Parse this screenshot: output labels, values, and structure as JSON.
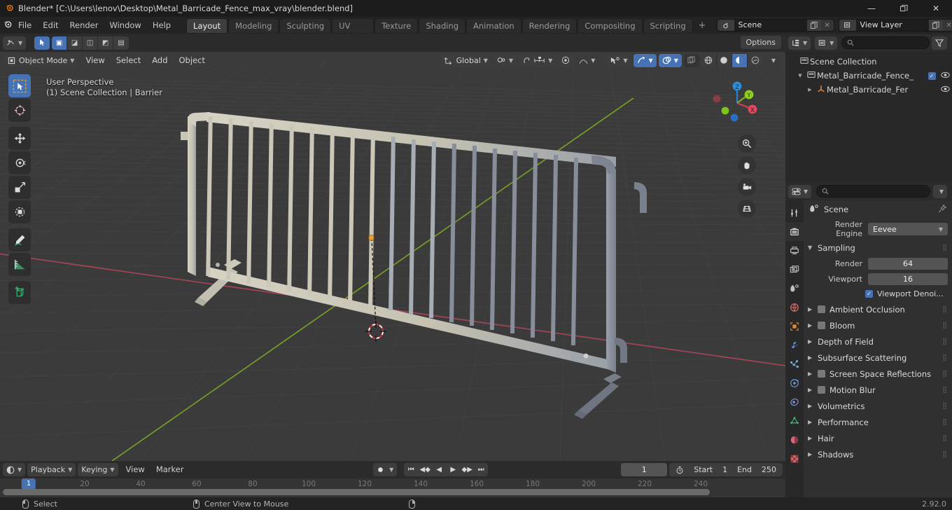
{
  "titlebar": {
    "app_icon": "blender-logo-icon",
    "title": "Blender* [C:\\Users\\lenov\\Desktop\\Metal_Barricade_Fence_max_vray\\blender.blend]",
    "minimize": "—",
    "restore": "❐",
    "close": "✕"
  },
  "topbar": {
    "menus": [
      "File",
      "Edit",
      "Render",
      "Window",
      "Help"
    ],
    "workspaces": [
      "Layout",
      "Modeling",
      "Sculpting",
      "UV Editing",
      "Texture Paint",
      "Shading",
      "Animation",
      "Rendering",
      "Compositing",
      "Scripting"
    ],
    "active_workspace": "Layout",
    "add_workspace": "+",
    "scene_name": "Scene",
    "view_layer_name": "View Layer"
  },
  "viewport": {
    "mode": "Object Mode",
    "menus": [
      "View",
      "Select",
      "Add",
      "Object"
    ],
    "transform_orientation": "Global",
    "options_label": "Options",
    "overlay_line1": "User Perspective",
    "overlay_line2": "(1) Scene Collection | Barrier",
    "gizmo_axes": [
      "X",
      "Y",
      "Z"
    ],
    "tools": [
      {
        "name": "select-box-tool",
        "active": true
      },
      {
        "name": "cursor-tool",
        "active": false
      },
      {
        "name": "move-tool",
        "active": false
      },
      {
        "name": "rotate-tool",
        "active": false
      },
      {
        "name": "scale-tool",
        "active": false
      },
      {
        "name": "transform-tool",
        "active": false
      },
      {
        "name": "annotate-tool",
        "active": false
      },
      {
        "name": "measure-tool",
        "active": false
      },
      {
        "name": "add-cube-tool",
        "active": false
      }
    ],
    "nav_buttons": [
      "zoom-icon",
      "pan-hand-icon",
      "camera-icon",
      "grid-ortho-icon"
    ],
    "shading_modes": [
      "wireframe",
      "solid",
      "material-preview",
      "rendered"
    ],
    "active_shading_mode": "material-preview"
  },
  "timeline": {
    "editor_menu": "playback-editor-icon",
    "menus": [
      "Playback",
      "Keying",
      "View",
      "Marker"
    ],
    "current_frame": "1",
    "start_label": "Start",
    "start_value": "1",
    "end_label": "End",
    "end_value": "250",
    "ruler_ticks": [
      "20",
      "40",
      "60",
      "80",
      "100",
      "120",
      "140",
      "160",
      "180",
      "200",
      "220",
      "240"
    ],
    "playhead_label": "1"
  },
  "outliner": {
    "search_placeholder": "",
    "rows": [
      {
        "label": "Scene Collection",
        "icon": "collection-icon",
        "indent": 0,
        "expand": "",
        "checkbox": false,
        "eye": false
      },
      {
        "label": "Metal_Barricade_Fence_",
        "icon": "collection-icon",
        "indent": 1,
        "expand": "▼",
        "checkbox": true,
        "eye": true
      },
      {
        "label": "Metal_Barricade_Fer",
        "icon": "object-data-icon",
        "indent": 2,
        "expand": "▶",
        "checkbox": false,
        "eye": true
      }
    ]
  },
  "properties": {
    "breadcrumb": "Scene",
    "render_engine_label": "Render Engine",
    "render_engine_value": "Eevee",
    "sampling": {
      "title": "Sampling",
      "render_label": "Render",
      "render_value": "64",
      "viewport_label": "Viewport",
      "viewport_value": "16",
      "denoising_label": "Viewport Denoi...",
      "denoising_checked": true
    },
    "panels": [
      {
        "label": "Ambient Occlusion",
        "checkbox": true
      },
      {
        "label": "Bloom",
        "checkbox": true
      },
      {
        "label": "Depth of Field",
        "checkbox": false
      },
      {
        "label": "Subsurface Scattering",
        "checkbox": false
      },
      {
        "label": "Screen Space Reflections",
        "checkbox": true
      },
      {
        "label": "Motion Blur",
        "checkbox": true
      },
      {
        "label": "Volumetrics",
        "checkbox": false
      },
      {
        "label": "Performance",
        "checkbox": false
      },
      {
        "label": "Hair",
        "checkbox": false
      },
      {
        "label": "Shadows",
        "checkbox": false
      }
    ],
    "tabs": [
      {
        "name": "tool-tab",
        "color": "#c8c8c8",
        "active": false
      },
      {
        "name": "render-tab",
        "color": "#d8d8d8",
        "active": true
      },
      {
        "name": "output-tab",
        "color": "#c0c0c0",
        "active": false
      },
      {
        "name": "view-layer-tab",
        "color": "#c0c0c0",
        "active": false
      },
      {
        "name": "scene-tab",
        "color": "#c0c0c0",
        "active": false
      },
      {
        "name": "world-tab",
        "color": "#d46a6a",
        "active": false
      },
      {
        "name": "object-tab",
        "color": "#e08a3c",
        "active": false
      },
      {
        "name": "modifier-tab",
        "color": "#5a8fd0",
        "active": false
      },
      {
        "name": "particles-tab",
        "color": "#7aa8d8",
        "active": false
      },
      {
        "name": "physics-tab",
        "color": "#6a9ad0",
        "active": false
      },
      {
        "name": "constraints-tab",
        "color": "#7a9ad0",
        "active": false
      },
      {
        "name": "object-data-tab",
        "color": "#3fba7a",
        "active": false
      },
      {
        "name": "material-tab",
        "color": "#d06a7a",
        "active": false
      },
      {
        "name": "texture-tab",
        "color": "#d06a6a",
        "active": false
      }
    ]
  },
  "statusbar": {
    "select_label": "Select",
    "center_view_label": "Center View to Mouse",
    "version": "2.92.0"
  },
  "colors": {
    "accent_blue": "#4772b3",
    "orange": "#e87d0d",
    "axis_x_red": "#cf4057",
    "axis_y_green": "#8fbb2a",
    "axis_z_blue": "#2a7fcf",
    "viewport_bg": "#3b3b3b",
    "fence_light": "#cfccbd",
    "fence_dark": "#7e8592"
  }
}
